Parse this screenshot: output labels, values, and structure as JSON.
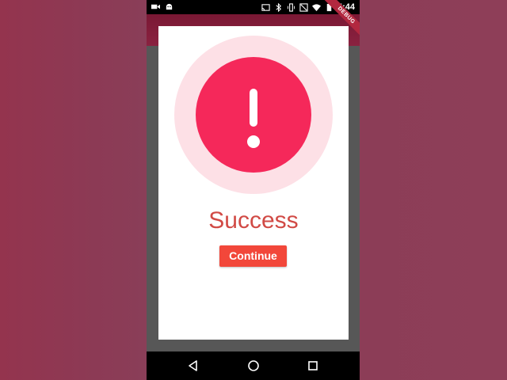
{
  "status_bar": {
    "time": "5:44",
    "left_icons": [
      "video-camera-icon",
      "android-icon"
    ],
    "right_icons": [
      "cast-icon",
      "bluetooth-icon",
      "vibrate-icon",
      "mute-icon",
      "wifi-icon",
      "battery-icon"
    ]
  },
  "debug_banner": {
    "label": "DEBUG"
  },
  "dialog": {
    "icon": "exclamation-icon",
    "title": "Success",
    "continue_label": "Continue"
  },
  "nav_bar": {
    "buttons": [
      "back-icon",
      "home-icon",
      "recents-icon"
    ]
  },
  "colors": {
    "alert": "#f5285a",
    "halo": "#fde0e6",
    "title": "#d14a45",
    "button": "#f2473a",
    "app_bar": "#7a1834"
  }
}
